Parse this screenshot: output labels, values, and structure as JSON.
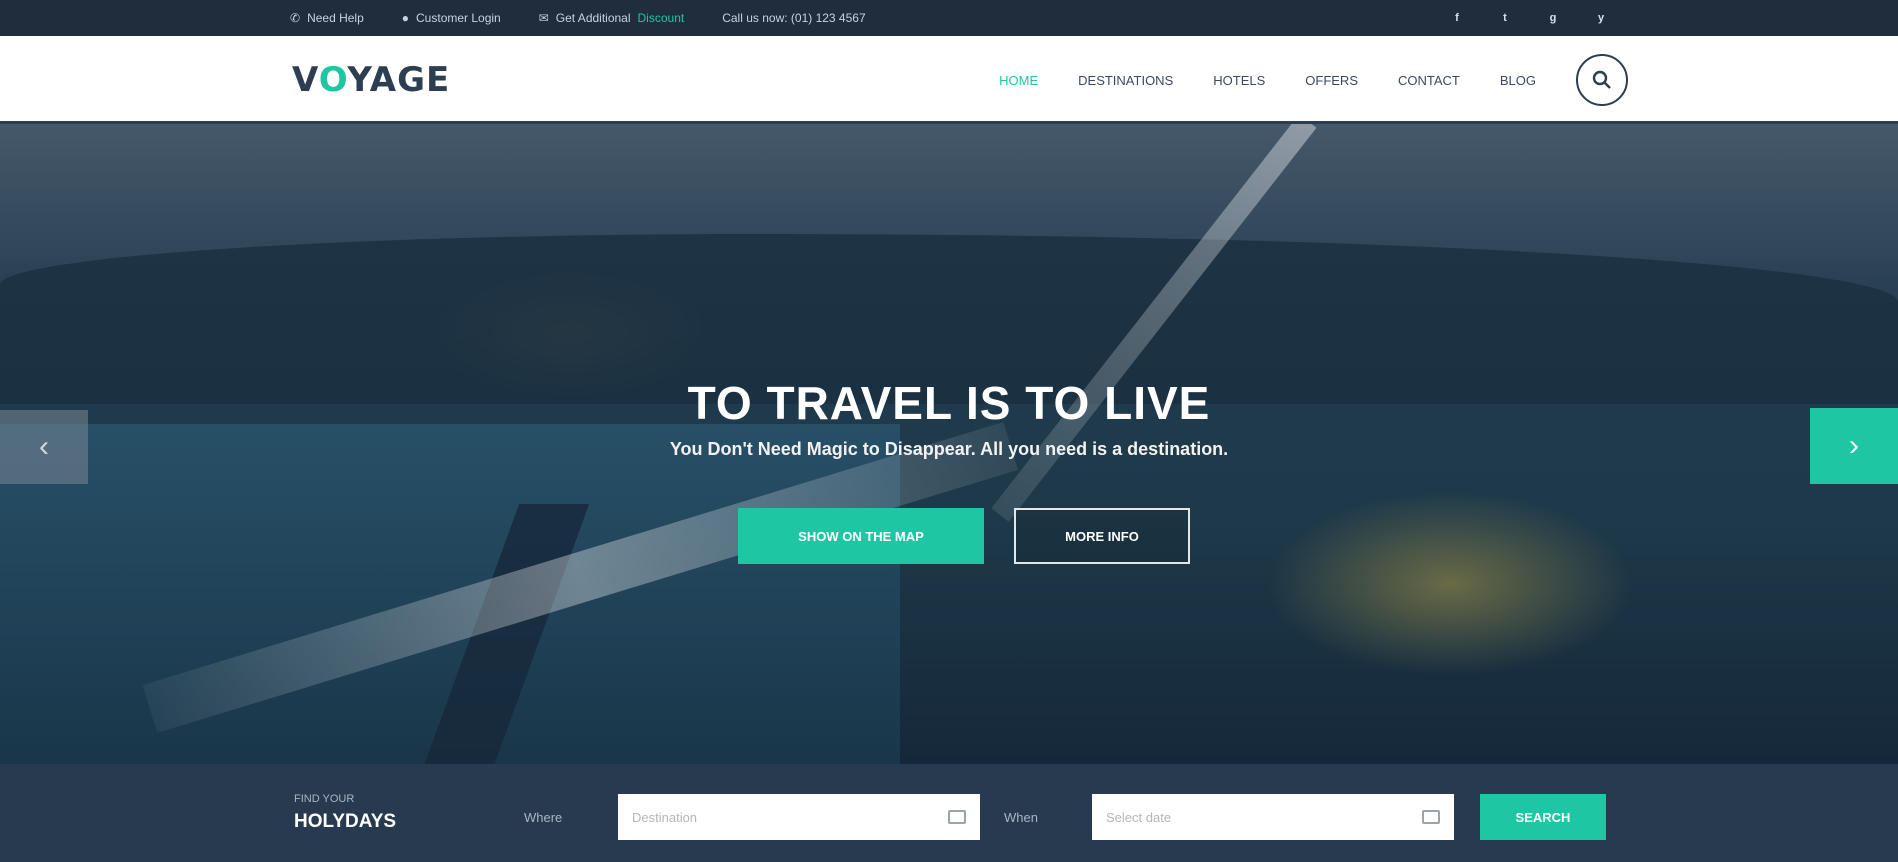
{
  "topbar": {
    "items": [
      {
        "icon": "phone-icon",
        "text": "Need Help"
      },
      {
        "icon": "user-icon",
        "text": "Customer Login"
      },
      {
        "icon": "chat-icon",
        "text": "Get Additional ",
        "highlight": "Discount"
      },
      {
        "icon": "",
        "text": "Call us now: (01) 123 4567"
      }
    ],
    "social": [
      "f",
      "t",
      "g",
      "y"
    ]
  },
  "header": {
    "logo_prefix": "V",
    "logo_o": "O",
    "logo_suffix": "YAGE",
    "nav": [
      "Home",
      "Destinations",
      "Hotels",
      "Offers",
      "Contact",
      "Blog"
    ]
  },
  "hero": {
    "title": "TO TRAVEL IS TO LIVE",
    "subtitle": "You Don't Need Magic to Disappear. All you need is a destination.",
    "primary_button": "Show on the map",
    "secondary_button": "More info",
    "prev_arrow": "‹",
    "next_arrow": "›"
  },
  "booking": {
    "label_small": "Find your",
    "label_big": "Holydays",
    "where_label": "Where",
    "where_placeholder": "Destination",
    "when_label": "When",
    "when_placeholder": "Select date",
    "search_button": "Search"
  },
  "colors": {
    "accent": "#1fc6a3",
    "dark": "#273a4f"
  }
}
